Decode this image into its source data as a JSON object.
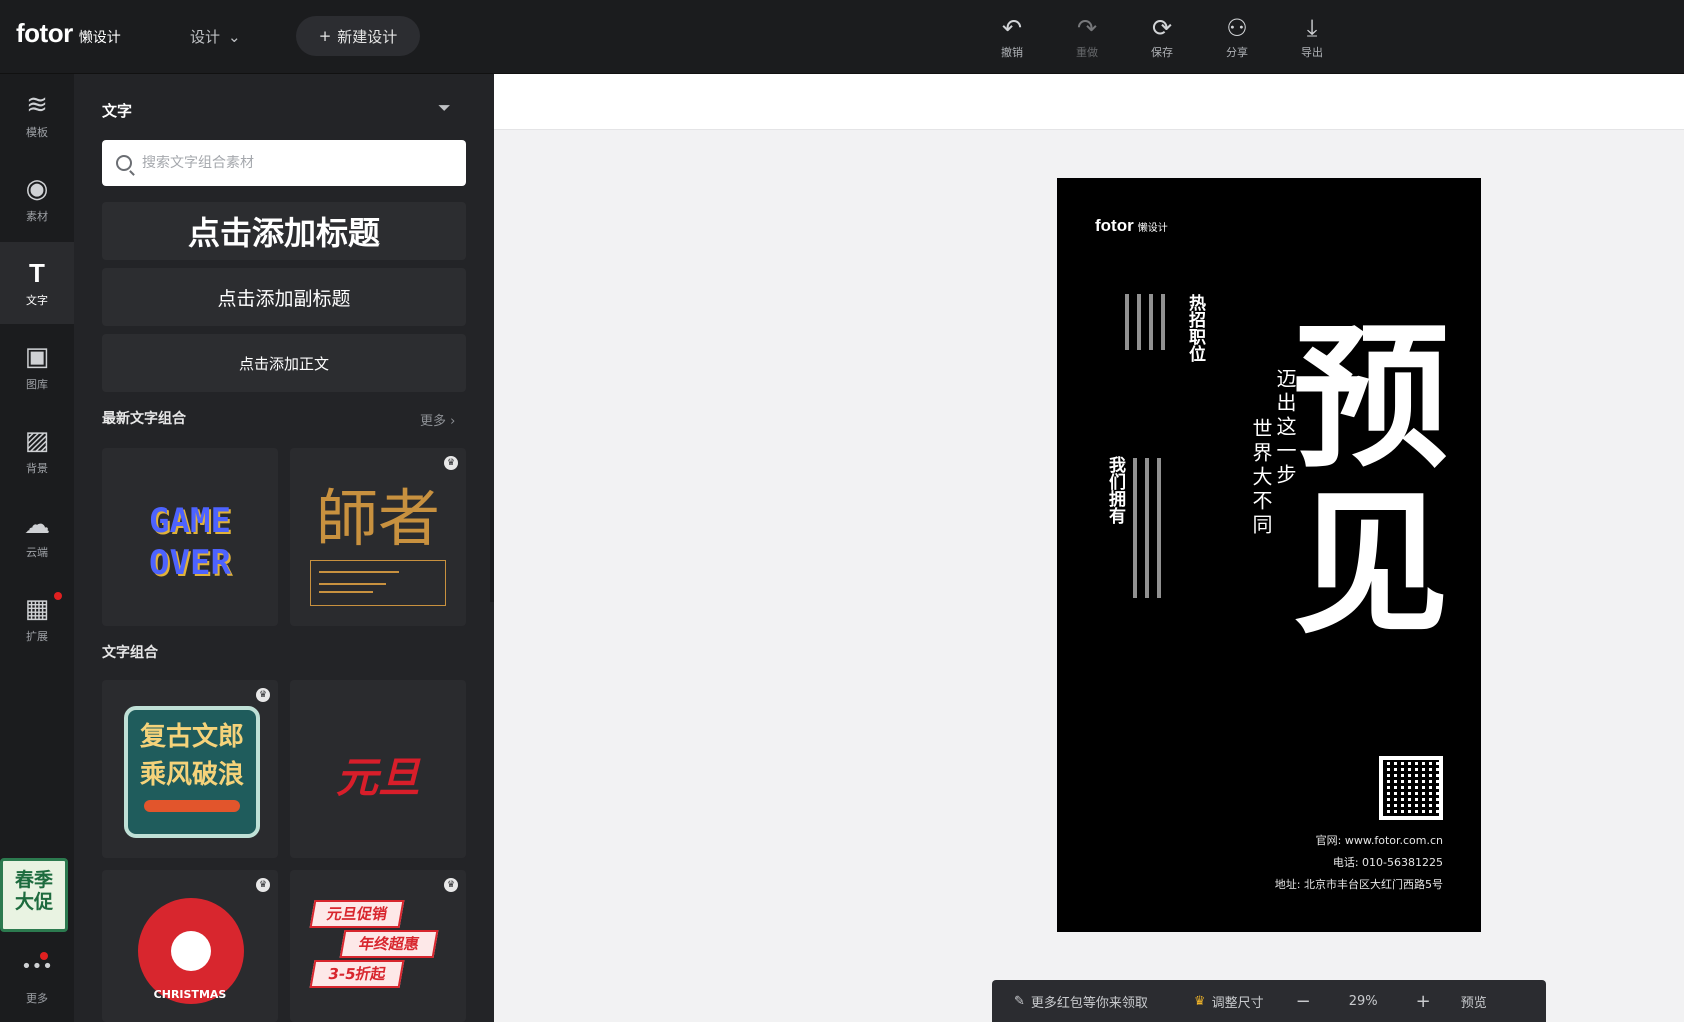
{
  "app": {
    "brand": "fotor",
    "brand_sub": "懒设计",
    "design_menu": "设计",
    "new_design": "新建设计",
    "toolbar": [
      {
        "icon": "undo-icon",
        "glyph": "↶",
        "label": "撤销"
      },
      {
        "icon": "redo-icon",
        "glyph": "↷",
        "label": "重做"
      },
      {
        "icon": "save-icon",
        "glyph": "⟳",
        "label": "保存"
      },
      {
        "icon": "share-icon",
        "glyph": "⚇",
        "label": "分享"
      },
      {
        "icon": "download-icon",
        "glyph": "⤓",
        "label": "导出"
      }
    ]
  },
  "rail": [
    {
      "icon": "template-icon",
      "glyph": "≋",
      "label": "模板"
    },
    {
      "icon": "element-icon",
      "glyph": "◉",
      "label": "素材"
    },
    {
      "icon": "text-icon",
      "glyph": "T",
      "label": "文字",
      "active": true
    },
    {
      "icon": "image-icon",
      "glyph": "▣",
      "label": "图库"
    },
    {
      "icon": "background-icon",
      "glyph": "▨",
      "label": "背景"
    },
    {
      "icon": "cloud-upload-icon",
      "glyph": "☁",
      "label": "云端"
    },
    {
      "icon": "apps-icon",
      "glyph": "▦",
      "label": "扩展"
    },
    {
      "icon": "more-icon",
      "glyph": "•••",
      "label": "更多"
    }
  ],
  "promo": {
    "line1": "春季",
    "line2": "大促"
  },
  "panel": {
    "title": "文字",
    "search_placeholder": "搜索文字组合素材",
    "add_title": "点击添加标题",
    "add_subtitle": "点击添加副标题",
    "add_body": "点击添加正文",
    "recent_section": "最新文字组合",
    "more_label": "更多 ›",
    "combo_section": "文字组合",
    "cards": {
      "game_over_1": "GAME",
      "game_over_2": "OVER",
      "shizhe": "師者",
      "retro_1": "复古文郎",
      "retro_2": "乘风破浪",
      "yuandan": "元旦",
      "christmas": "CHRISTMAS",
      "sale_1": "元旦促销",
      "sale_2": "年终超惠",
      "sale_3": "3-5折起"
    }
  },
  "poster": {
    "logo": "fotor",
    "logo_sub": "懒设计",
    "big_1": "预",
    "big_2": "见",
    "slogan_1": "迈出这一步",
    "slogan_2": "世界大不同",
    "hot_title": "热招职位",
    "we_have": "我们拥有",
    "site": "官网: www.fotor.com.cn",
    "phone": "电话: 010-56381225",
    "address": "地址: 北京市丰台区大红门西路5号"
  },
  "zoom": {
    "tip": "更多红包等你来领取",
    "resize": "调整尺寸",
    "minus": "−",
    "value": "29%",
    "plus": "+",
    "preview": "预览"
  }
}
